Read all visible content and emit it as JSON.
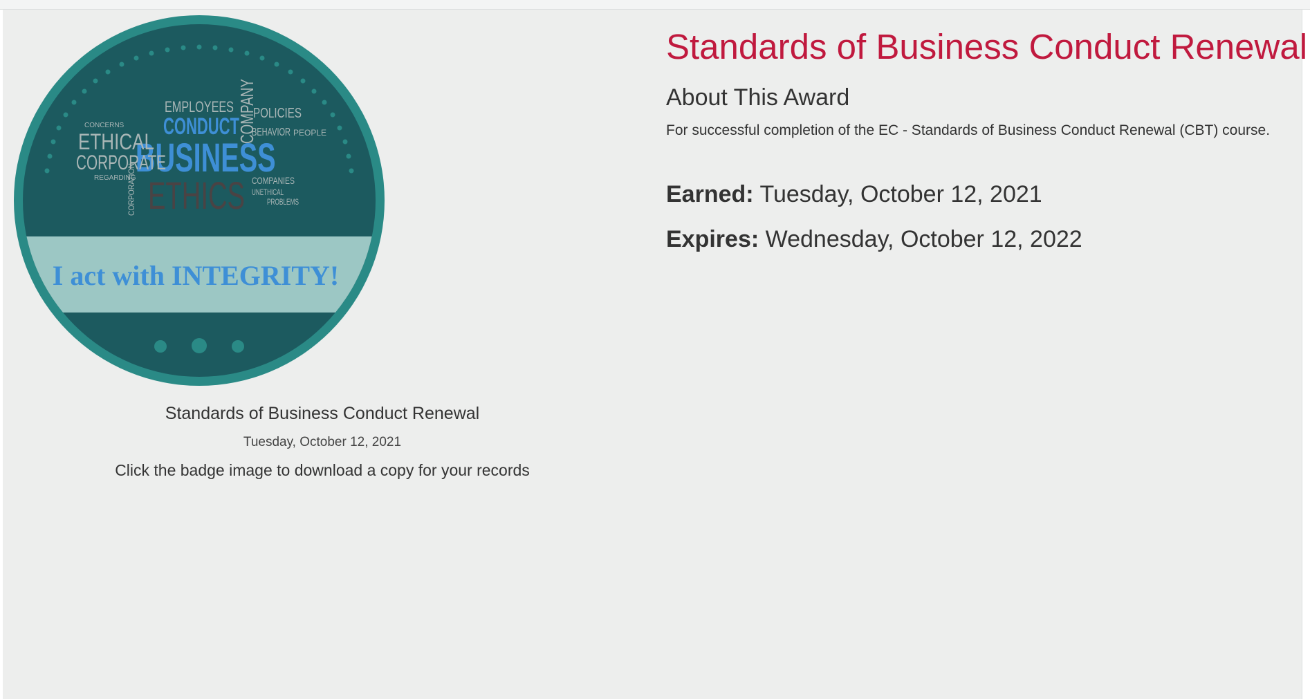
{
  "badge": {
    "banner_text": "I act with INTEGRITY!",
    "cloud_words": {
      "business": "BUSINESS",
      "ethics": "ETHICS",
      "conduct": "CONDUCT",
      "ethical": "ETHICAL",
      "corporate": "CORPORATE",
      "employees": "EMPLOYEES",
      "company": "COMPANY",
      "policies": "POLICIES",
      "behavior": "BEHAVIOR",
      "people": "PEOPLE",
      "companies": "COMPANIES",
      "unethical": "UNETHICAL",
      "problems": "PROBLEMS",
      "corporation": "CORPORATION",
      "concerns": "CONCERNS",
      "regarding": "REGARDING"
    },
    "colors": {
      "ring": "#2a8a86",
      "inner": "#1c5a5f",
      "banner": "#9cc7c4",
      "banner_text": "#3e8fd6",
      "word_blue": "#3e8fd6",
      "word_grey": "#a9b6b6",
      "word_dark": "#4a4344"
    }
  },
  "caption": {
    "title": "Standards of Business Conduct Renewal",
    "date": "Tuesday, October 12, 2021",
    "hint": "Click the badge image to download a copy for your records"
  },
  "award": {
    "title": "Standards of Business Conduct Renewal",
    "about_heading": "About This Award",
    "description": "For successful completion of the EC - Standards of Business Conduct Renewal (CBT) course.",
    "earned_label": "Earned:",
    "earned_value": "Tuesday, October 12, 2021",
    "expires_label": "Expires:",
    "expires_value": "Wednesday, October 12, 2022"
  },
  "colors": {
    "title_red": "#c0193e",
    "page_bg": "#edeeed"
  }
}
